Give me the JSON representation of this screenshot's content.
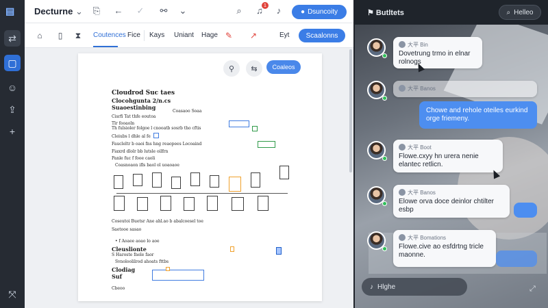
{
  "doc": {
    "title": "Decturne",
    "share_label": "Dsuncoity",
    "notif_count": "1",
    "tabs": [
      "Coutences",
      "Fice",
      "Kays",
      "Uniant",
      "Hage"
    ],
    "edit_label": "Eyt",
    "send_label": "Scaalonns",
    "page_cta": "Coaleos",
    "lines": {
      "h1": "Cloudrod Suc taes",
      "h2": "Clocohgunta 2/n.cs",
      "h3": "Suaoestinbing",
      "l1": "Cisrfi Tat thfe eoutoa",
      "l2": "Th fulsioler folgoe l cnooatb sosrb tho cftis",
      "l3": "Cleiubs l dhle al fe",
      "l4": "Faucleltr b oaoi fns hng reaopees Locoaind",
      "l5": "Fiaxrd dlolr bb lutsle oilfrn",
      "l6": "Panle fuc f fooe caoli",
      "l7": "Coasnoaon ifls baol ol uoaoaoe",
      "l8": "Coseutoi Buetsr Ane ahl.ao b abalcoesel toe",
      "l9": "Cleuslionte",
      "l10": "S Haroste fnele faor",
      "l11": "Svnoloolilrod ahoats fttbs",
      "l12": "Suf",
      "l13": "Clodiag",
      "l14": "Cbeoo"
    }
  },
  "chat": {
    "title": "Butltets",
    "help_label": "Helleo",
    "input_placeholder": "Hlghe",
    "messages": [
      {
        "who": "大平 Bin",
        "text": "Dovetrung trmo in elnar\nrolnogs"
      },
      {
        "who": "大平 Banos",
        "text": ""
      },
      {
        "who": "大平 Boot",
        "text": "Flowe.cxyy hn urera nenie\nelantec retlicn."
      },
      {
        "who": "大平 Banos",
        "text": "Elowe orva doce deinlor chtilter\nesbp"
      },
      {
        "who": "大平 Bomations",
        "text": "Flowe.cive ao esfdrtng tricle\nmaonne."
      }
    ],
    "outgoing": [
      {
        "text": "Chowe and rehole oteiles eurkind\norge friemeny."
      }
    ]
  }
}
